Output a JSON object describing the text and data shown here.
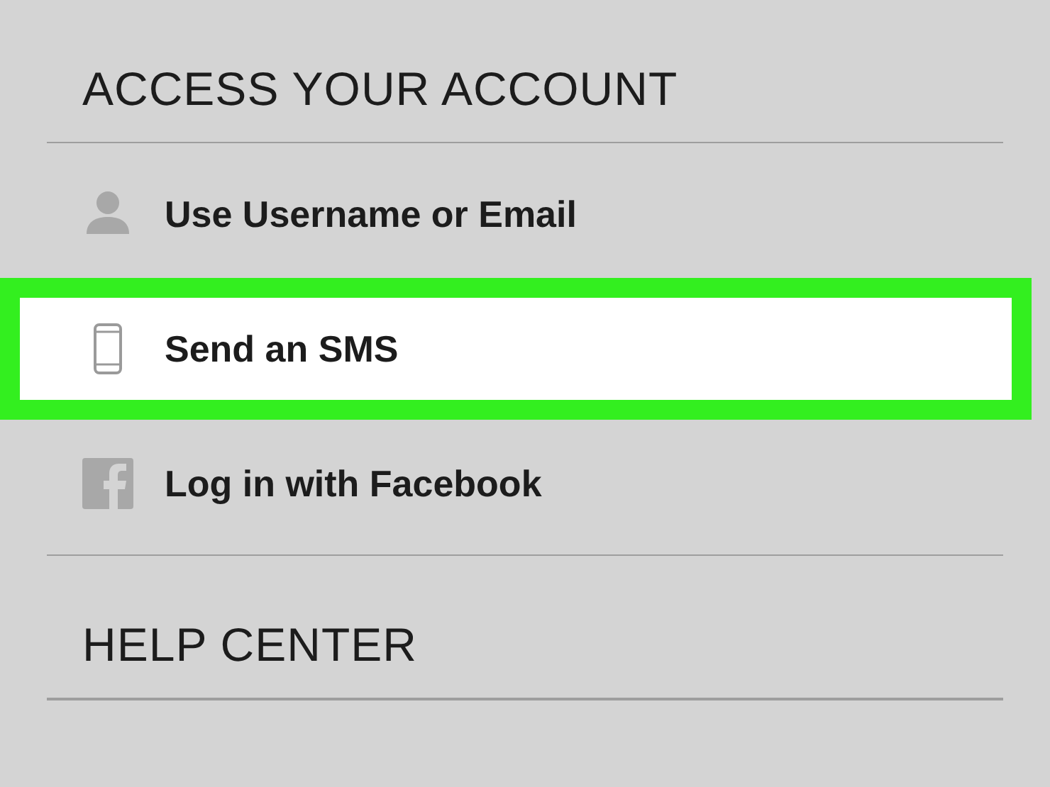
{
  "sections": [
    {
      "title": "ACCESS YOUR ACCOUNT",
      "items": [
        {
          "kind": "person",
          "label": "Use Username or Email",
          "selected": false
        },
        {
          "kind": "phone",
          "label": "Send an SMS",
          "selected": true
        },
        {
          "kind": "facebook",
          "label": "Log in with Facebook",
          "selected": false
        }
      ]
    },
    {
      "title": "HELP CENTER"
    }
  ]
}
